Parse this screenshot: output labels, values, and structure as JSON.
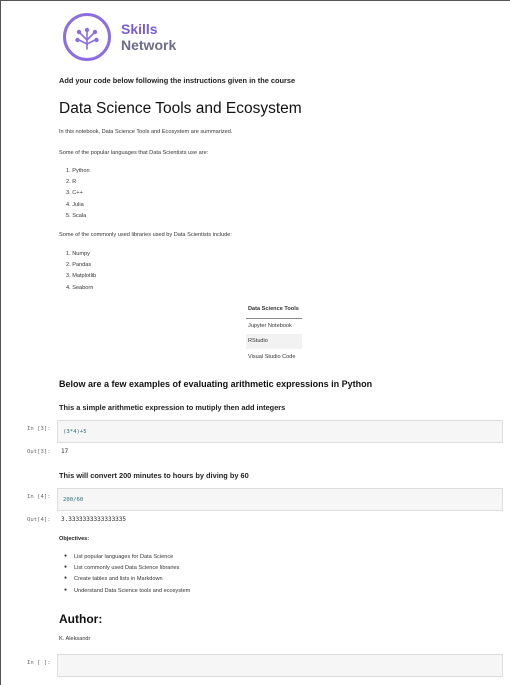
{
  "logo": {
    "line1": "Skills",
    "line2": "Network"
  },
  "instruction": "Add your code below following the instructions given in the course",
  "title": "Data Science Tools and Ecosystem",
  "intro": "In this notebook, Data Science Tools and Ecosystem are summarized.",
  "languages_intro": "Some of the popular languages that Data Scientists use are:",
  "languages": [
    "1. Python",
    "2. R",
    "3. C++",
    "4. Julia",
    "5. Scala"
  ],
  "libraries_intro": "Some of the commonly used libraries used by Data Scientists include:",
  "libraries": [
    "1. Numpy",
    "2. Pandas",
    "3. Matplotlib",
    "4. Seaborn"
  ],
  "tools_table": {
    "header": "Data Science Tools",
    "rows": [
      "Jupyter Notebook",
      "RStudio",
      "Visual Studio Code"
    ]
  },
  "arith_heading": "Below are a few examples of evaluating arithmetic expressions in Python",
  "cell3": {
    "description": "This a simple arithmetic expression to mutiply then add integers",
    "in_prompt": "In [3]:",
    "code": "(3*4)+5",
    "out_prompt": "Out[3]:",
    "output": "17"
  },
  "cell4": {
    "description": "This will convert 200 minutes to hours by diving by 60",
    "in_prompt": "In [4]:",
    "code": "200/60",
    "out_prompt": "Out[4]:",
    "output": "3.3333333333333335"
  },
  "objectives_label": "Objectives:",
  "objectives": [
    "List popular languages for Data Science",
    "List commonly used Data Science libraries",
    "Create tables and lists in Markdown",
    "Understand Data Science tools and ecosystem"
  ],
  "author_heading": "Author:",
  "author_name": "K. Aleksandr",
  "empty_cell": {
    "in_prompt": "In [ ]:"
  },
  "colors": {
    "accent": "#8c6ee0",
    "code": "#2a6e7a"
  }
}
